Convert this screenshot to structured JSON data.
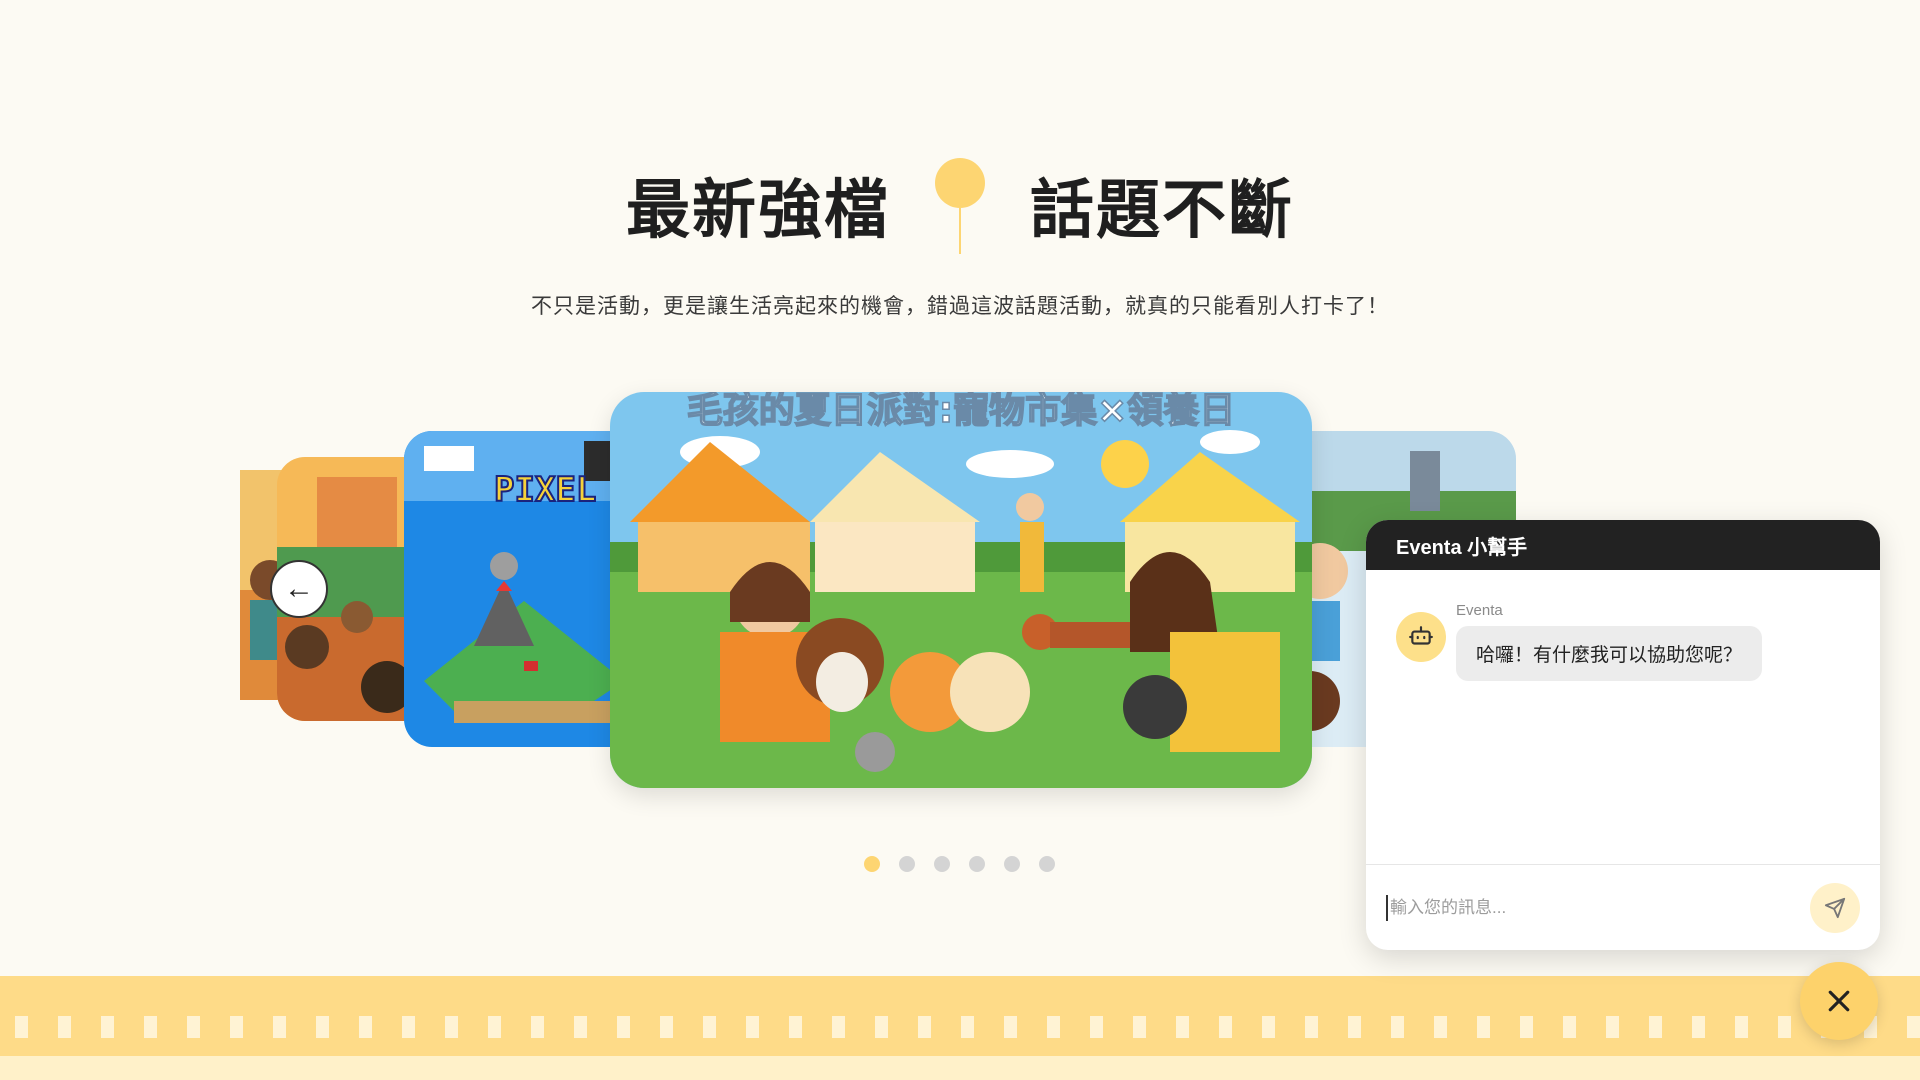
{
  "section": {
    "title_left": "最新強檔",
    "title_right": "話題不斷",
    "subtitle": "不只是活動，更是讓生活亮起來的機會，錯過這波話題活動，就真的只能看別人打卡了！"
  },
  "carousel": {
    "featured_title": "毛孩的夏日派對:寵物市集×領養日",
    "pixel_card_text": "PIXEL",
    "prev_arrow": "←",
    "slide_count": 6,
    "active_index": 0
  },
  "chat": {
    "title": "Eventa 小幫手",
    "sender": "Eventa",
    "message": "哈囉！有什麼我可以協助您呢？",
    "input_placeholder": "輸入您的訊息..."
  },
  "colors": {
    "accent_yellow": "#fdd572",
    "background": "#fcfaf3",
    "header_dark": "#222222"
  },
  "icons": {
    "bot": "bot-icon",
    "send": "send-icon",
    "close": "close-icon",
    "balloon": "balloon-icon"
  }
}
